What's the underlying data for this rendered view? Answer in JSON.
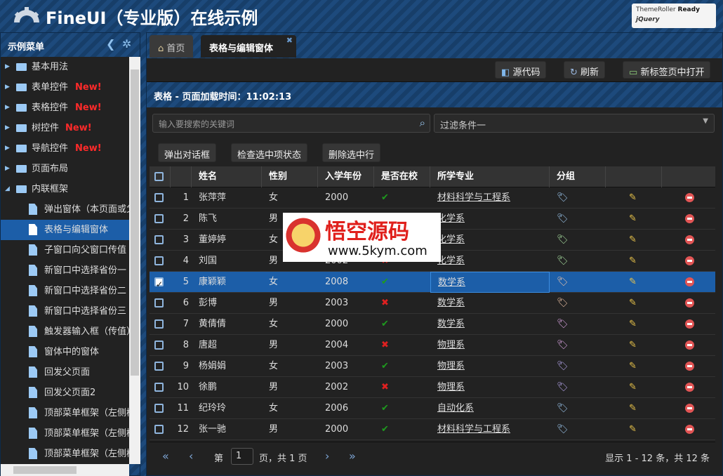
{
  "header": {
    "title": "FineUI（专业版）在线示例",
    "badge_line1_a": "ThemeRoller",
    "badge_line1_b": "Ready",
    "badge_line2": "jQuery"
  },
  "sidebar": {
    "title": "示例菜单",
    "collapse_icon": "chevron-left-icon",
    "settings_icon": "gear-icon",
    "items": [
      {
        "label": "基本用法",
        "new": ""
      },
      {
        "label": "表单控件",
        "new": "New!"
      },
      {
        "label": "表格控件",
        "new": "New!"
      },
      {
        "label": "树控件",
        "new": "New!"
      },
      {
        "label": "导航控件",
        "new": "New!"
      },
      {
        "label": "页面布局",
        "new": ""
      },
      {
        "label": "内联框架",
        "new": ""
      }
    ],
    "children": [
      {
        "label": "弹出窗体（本页面或父页面）"
      },
      {
        "label": "表格与编辑窗体",
        "selected": true
      },
      {
        "label": "子窗口向父窗口传值"
      },
      {
        "label": "新窗口中选择省份一"
      },
      {
        "label": "新窗口中选择省份二"
      },
      {
        "label": "新窗口中选择省份三"
      },
      {
        "label": "触发器输入框（传值）"
      },
      {
        "label": "窗体中的窗体"
      },
      {
        "label": "回发父页面"
      },
      {
        "label": "回发父页面2"
      },
      {
        "label": "顶部菜单框架（左侧树）"
      },
      {
        "label": "顶部菜单框架（左侧树）"
      },
      {
        "label": "顶部菜单框架（左侧树）"
      }
    ]
  },
  "tabs": [
    {
      "label": "首页"
    },
    {
      "label": "表格与编辑窗体"
    }
  ],
  "toolbar": {
    "source": "源代码",
    "refresh": "刷新",
    "open_new": "新标签页中打开"
  },
  "panel": {
    "title": "表格 - 页面加载时间：11:02:13"
  },
  "search": {
    "placeholder": "输入要搜索的关键词",
    "filter": "过滤条件一"
  },
  "buttons": {
    "dialog": "弹出对话框",
    "check": "检查选中项状态",
    "delete": "删除选中行"
  },
  "grid": {
    "headers": {
      "name": "姓名",
      "gender": "性别",
      "year": "入学年份",
      "atschool": "是否在校",
      "major": "所学专业",
      "group": "分组"
    },
    "rows": [
      {
        "n": "1",
        "name": "张萍萍",
        "gender": "女",
        "year": "2000",
        "atschool": true,
        "major": "材料科学与工程系",
        "tag": "#9cc8f0"
      },
      {
        "n": "2",
        "name": "陈飞",
        "gender": "男",
        "year": "",
        "atschool": null,
        "major": "化学系",
        "tag": "#9cc8f0"
      },
      {
        "n": "3",
        "name": "董婷婷",
        "gender": "女",
        "year": "",
        "atschool": null,
        "major": "化学系",
        "tag": "#a8e0a0"
      },
      {
        "n": "4",
        "name": "刘国",
        "gender": "男",
        "year": "2002",
        "atschool": false,
        "major": "化学系",
        "tag": "#a8e0a0"
      },
      {
        "n": "5",
        "name": "康颖颖",
        "gender": "女",
        "year": "2008",
        "atschool": true,
        "major": "数学系",
        "tag": "#f3c6a8",
        "selected": true
      },
      {
        "n": "6",
        "name": "彭博",
        "gender": "男",
        "year": "2003",
        "atschool": false,
        "major": "数学系",
        "tag": "#f3c6a8"
      },
      {
        "n": "7",
        "name": "黄倩倩",
        "gender": "女",
        "year": "2000",
        "atschool": true,
        "major": "数学系",
        "tag": "#e0a8e8"
      },
      {
        "n": "8",
        "name": "唐超",
        "gender": "男",
        "year": "2004",
        "atschool": false,
        "major": "物理系",
        "tag": "#e0a8e8"
      },
      {
        "n": "9",
        "name": "杨娟娟",
        "gender": "女",
        "year": "2003",
        "atschool": true,
        "major": "物理系",
        "tag": "#b8a8f0"
      },
      {
        "n": "10",
        "name": "徐鹏",
        "gender": "男",
        "year": "2002",
        "atschool": false,
        "major": "物理系",
        "tag": "#b8a8f0"
      },
      {
        "n": "11",
        "name": "纪玲玲",
        "gender": "女",
        "year": "2006",
        "atschool": true,
        "major": "自动化系",
        "tag": "#9cc8f0"
      },
      {
        "n": "12",
        "name": "张一驰",
        "gender": "男",
        "year": "2000",
        "atschool": true,
        "major": "材料科学与工程系",
        "tag": "#9cc8f0"
      }
    ]
  },
  "pager": {
    "prefix": "第",
    "page": "1",
    "suffix": "页，共 1 页",
    "summary": "显示 1 - 12 条，共 12 条"
  },
  "watermark": {
    "title": "悟空源码",
    "url": "www.5kym.com"
  }
}
